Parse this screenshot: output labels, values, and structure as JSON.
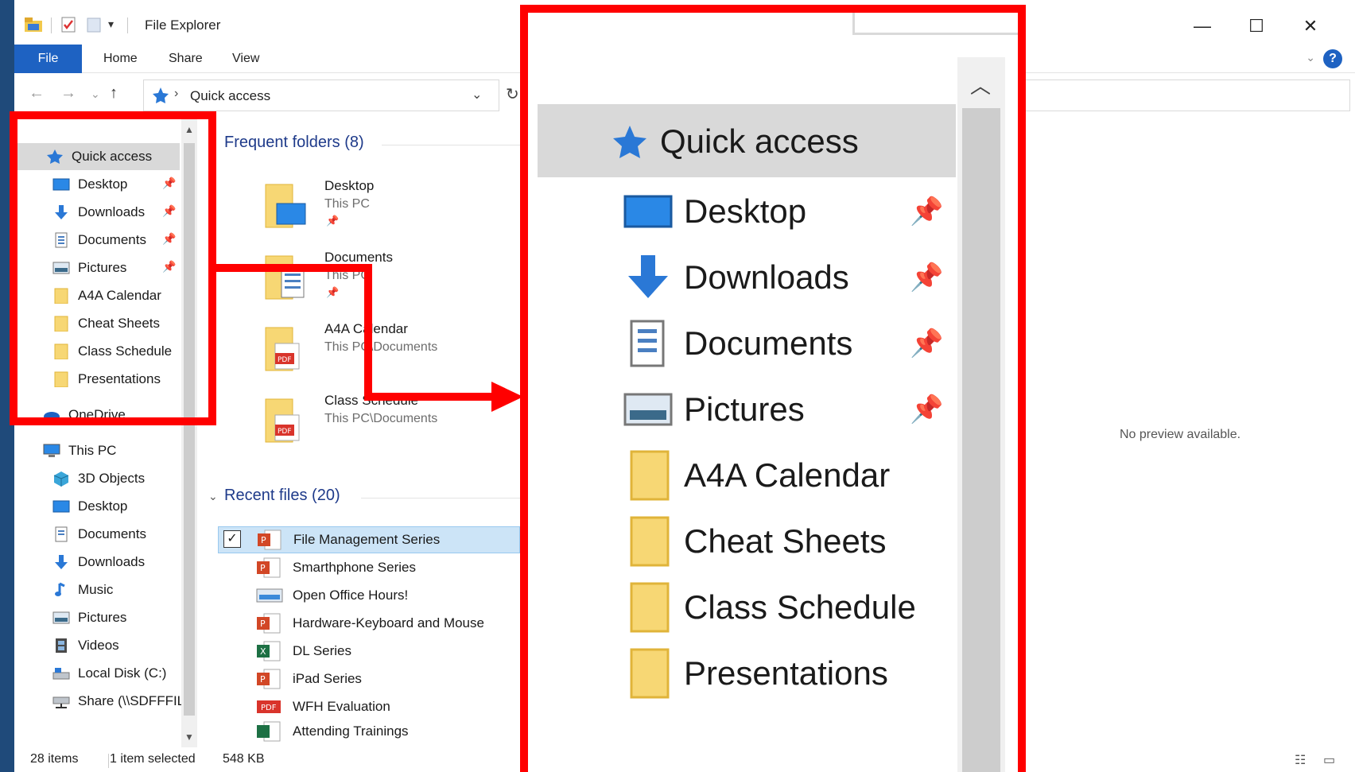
{
  "window": {
    "title": "File Explorer",
    "controls": {
      "minimize": "—",
      "maximize": "☐",
      "close": "✕"
    }
  },
  "ribbon": {
    "tabs": [
      "File",
      "Home",
      "Share",
      "View"
    ],
    "help": "?"
  },
  "address": {
    "path": "Quick access",
    "glyphs": {
      "back": "←",
      "forward": "→",
      "recent": "⌄",
      "up": "↑",
      "sep": "›",
      "dropdown": "⌄",
      "refresh": "↻"
    }
  },
  "sidebar": {
    "quick_access": "Quick access",
    "pinned": [
      "Desktop",
      "Downloads",
      "Documents",
      "Pictures"
    ],
    "folders": [
      "A4A Calendar",
      "Cheat Sheets",
      "Class Schedule",
      "Presentations"
    ],
    "onedrive": "OneDrive",
    "this_pc": "This PC",
    "this_pc_items": [
      "3D Objects",
      "Desktop",
      "Documents",
      "Downloads",
      "Music",
      "Pictures",
      "Videos",
      "Local Disk (C:)",
      "Share (\\\\SDFFFIL"
    ]
  },
  "content": {
    "frequent_header": "Frequent folders (8)",
    "frequent": [
      {
        "name": "Desktop",
        "path": "This PC"
      },
      {
        "name": "Documents",
        "path": "This PC"
      },
      {
        "name": "A4A Calendar",
        "path": "This PC\\Documents"
      },
      {
        "name": "Class Schedule",
        "path": "This PC\\Documents"
      }
    ],
    "recent_header": "Recent files (20)",
    "recent": [
      "File Management Series",
      "Smarthphone Series",
      "Open Office Hours!",
      "Hardware-Keyboard and Mouse",
      "DL Series",
      "iPad Series",
      "WFH Evaluation",
      "Attending Trainings"
    ],
    "selected_check": "✓"
  },
  "preview": {
    "text": "No preview available."
  },
  "status": {
    "items": "28 items",
    "selected": "1 item selected",
    "size": "548 KB"
  },
  "zoom": {
    "quick_access": "Quick access",
    "items": [
      "Desktop",
      "Downloads",
      "Documents",
      "Pictures",
      "A4A Calendar",
      "Cheat Sheets",
      "Class Schedule",
      "Presentations"
    ]
  },
  "colors": {
    "highlight": "#ff0000",
    "accent": "#1e62c2",
    "selection": "#cce4f7"
  }
}
